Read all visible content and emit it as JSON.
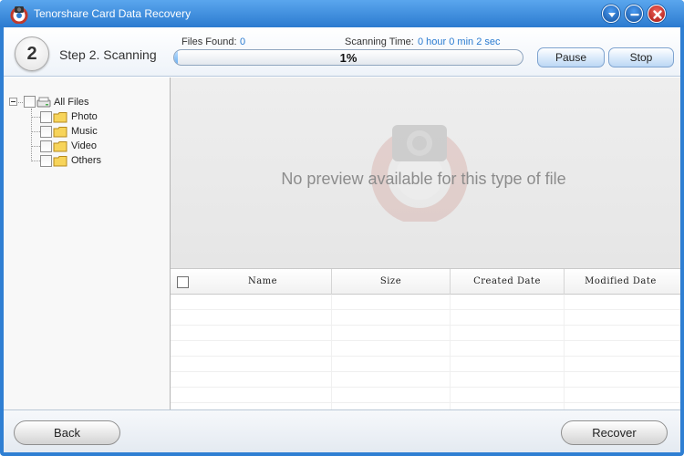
{
  "window": {
    "title": "Tenorshare Card Data Recovery"
  },
  "step": {
    "number": "2",
    "label": "Step 2. Scanning"
  },
  "scan": {
    "files_found_label": "Files Found:",
    "files_found_value": "0",
    "time_label": "Scanning Time:",
    "time_value": "0 hour 0 min 2 sec",
    "progress_percent": 1,
    "progress_text": "1%"
  },
  "buttons": {
    "pause": "Pause",
    "stop": "Stop",
    "back": "Back",
    "recover": "Recover"
  },
  "tree": {
    "root": "All Files",
    "children": [
      "Photo",
      "Music",
      "Video",
      "Others"
    ]
  },
  "preview": {
    "message": "No preview available for this type of file"
  },
  "table": {
    "columns": [
      "Name",
      "Size",
      "Created Date",
      "Modified Date"
    ],
    "rows": []
  },
  "colors": {
    "accent": "#2a7bd0",
    "title_bar": "#2c7bd0",
    "close_button": "#c9302c"
  },
  "icons": {
    "logo": "lifebuoy-camera-icon",
    "window_controls": [
      "dropdown-icon",
      "minimize-icon",
      "close-icon"
    ],
    "tree": [
      "drive-icon",
      "folder-icon"
    ]
  }
}
